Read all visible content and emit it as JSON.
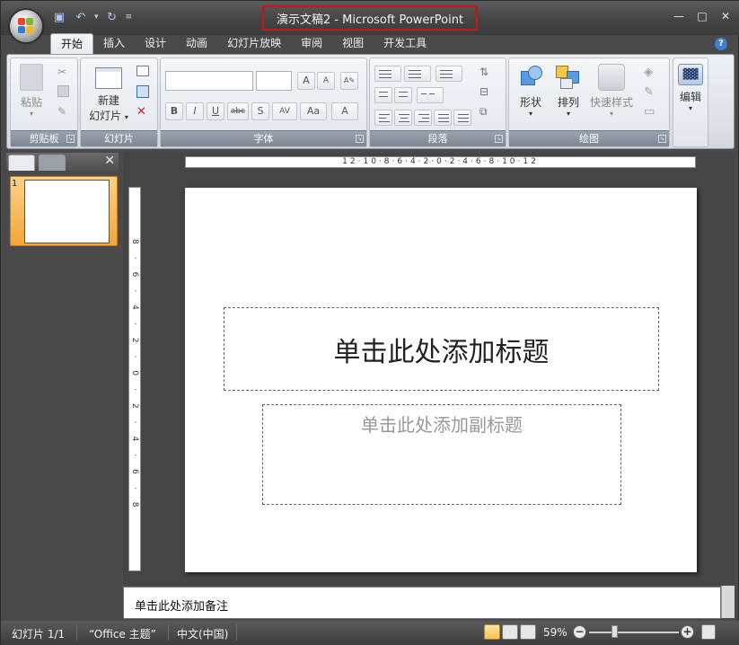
{
  "window": {
    "title": "演示文稿2 - Microsoft PowerPoint",
    "minimize": "—",
    "maximize": "□",
    "close": "✕"
  },
  "ribbon_tabs": [
    "开始",
    "插入",
    "设计",
    "动画",
    "幻灯片放映",
    "审阅",
    "视图",
    "开发工具"
  ],
  "groups": {
    "clipboard": {
      "label": "剪贴板",
      "paste": "粘贴"
    },
    "slides": {
      "label": "幻灯片",
      "new_slide_1": "新建",
      "new_slide_2": "幻灯片"
    },
    "font": {
      "label": "字体"
    },
    "paragraph": {
      "label": "段落"
    },
    "drawing": {
      "label": "绘图",
      "shapes": "形状",
      "arrange": "排列",
      "quick_styles": "快速样式"
    },
    "editing": {
      "label": "编辑"
    }
  },
  "font_buttons": [
    "B",
    "I",
    "U",
    "abc",
    "S",
    "AV",
    "Aa",
    "A"
  ],
  "ruler": {
    "horizontal": "12·10·8·6·4·2·0·2·4·6·8·10·12",
    "vertical": "8·6·4·2·0·2·4·6·8"
  },
  "thumbnail": {
    "number": "1"
  },
  "slide": {
    "title_placeholder": "单击此处添加标题",
    "subtitle_placeholder": "单击此处添加副标题"
  },
  "notes": {
    "placeholder": "单击此处添加备注"
  },
  "statusbar": {
    "slide_count": "幻灯片 1/1",
    "theme": "“Office 主题”",
    "language": "中文(中国)",
    "zoom": "59%"
  },
  "colors": {
    "frame": "#4a4a4a",
    "ribbon": "#dde1e7",
    "title_highlight": "#c8151b",
    "thumb_selected": "#f2a63a"
  }
}
